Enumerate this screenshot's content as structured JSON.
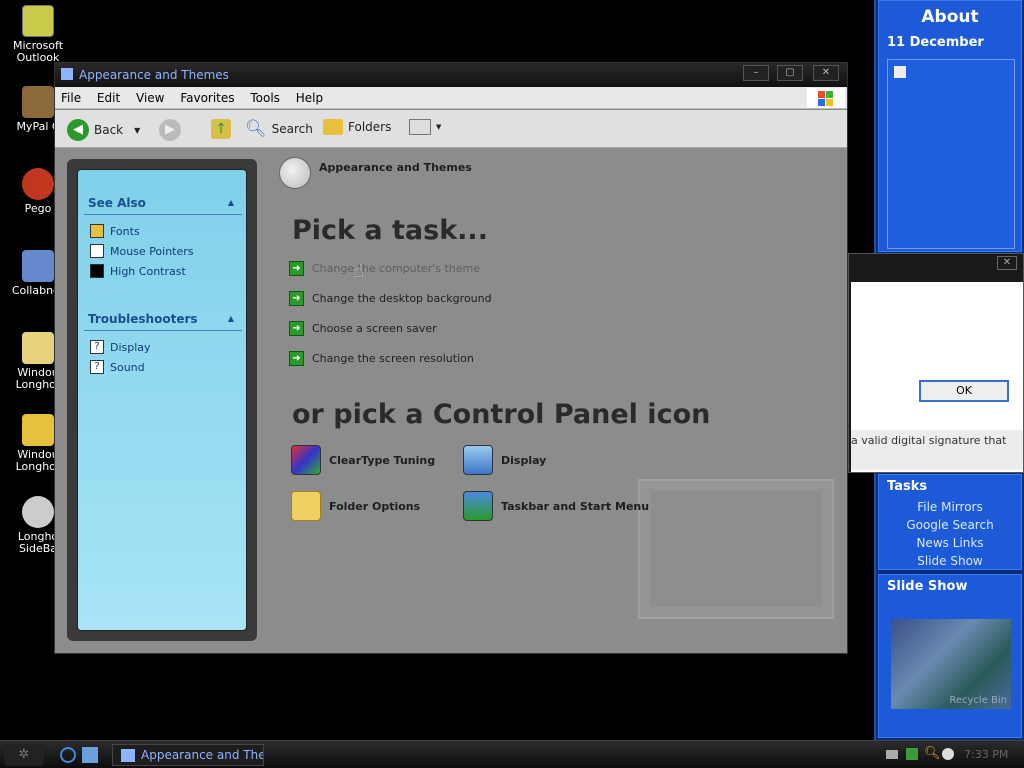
{
  "desktop": {
    "icons": [
      {
        "label": "Microsoft Outlook"
      },
      {
        "label": "MyPal C"
      },
      {
        "label": "Pego"
      },
      {
        "label": "Collabnet"
      },
      {
        "label": "Windou Longhor"
      },
      {
        "label": "Windou Longhor"
      },
      {
        "label": "Longho SideBa"
      }
    ]
  },
  "sidebar": {
    "title": "About",
    "date": "11 December",
    "tasks_header": "Tasks",
    "tasks": [
      "File Mirrors",
      "Google Search",
      "News Links",
      "Slide Show"
    ],
    "slideshow_header": "Slide Show",
    "slideshow_caption": "Recycle Bin"
  },
  "window": {
    "title": "Appearance and Themes",
    "menu": [
      "File",
      "Edit",
      "View",
      "Favorites",
      "Tools",
      "Help"
    ],
    "toolbar": {
      "back": "Back",
      "search": "Search",
      "folders": "Folders"
    },
    "breadcrumb": "Appearance and Themes",
    "left_pane": {
      "see_also_header": "See Also",
      "see_also": [
        "Fonts",
        "Mouse Pointers",
        "High Contrast"
      ],
      "troubleshooters_header": "Troubleshooters",
      "troubleshooters": [
        "Display",
        "Sound"
      ]
    },
    "pick_task_heading": "Pick a task...",
    "tasks": [
      "Change the computer's theme",
      "Change the desktop background",
      "Choose a screen saver",
      "Change the screen resolution"
    ],
    "pick_icon_heading": "or pick a Control Panel icon",
    "icons": [
      "ClearType Tuning",
      "Display",
      "Folder Options",
      "Taskbar and Start Menu"
    ]
  },
  "dialog": {
    "ok_label": "OK",
    "message": "a valid digital signature that"
  },
  "taskbar": {
    "active_window": "Appearance and The...",
    "clock": "7:33 PM"
  },
  "colors": {
    "accent": "#1c5ad8",
    "title_text": "#8fb4ff",
    "task_arrow": "#2a9a2a"
  }
}
